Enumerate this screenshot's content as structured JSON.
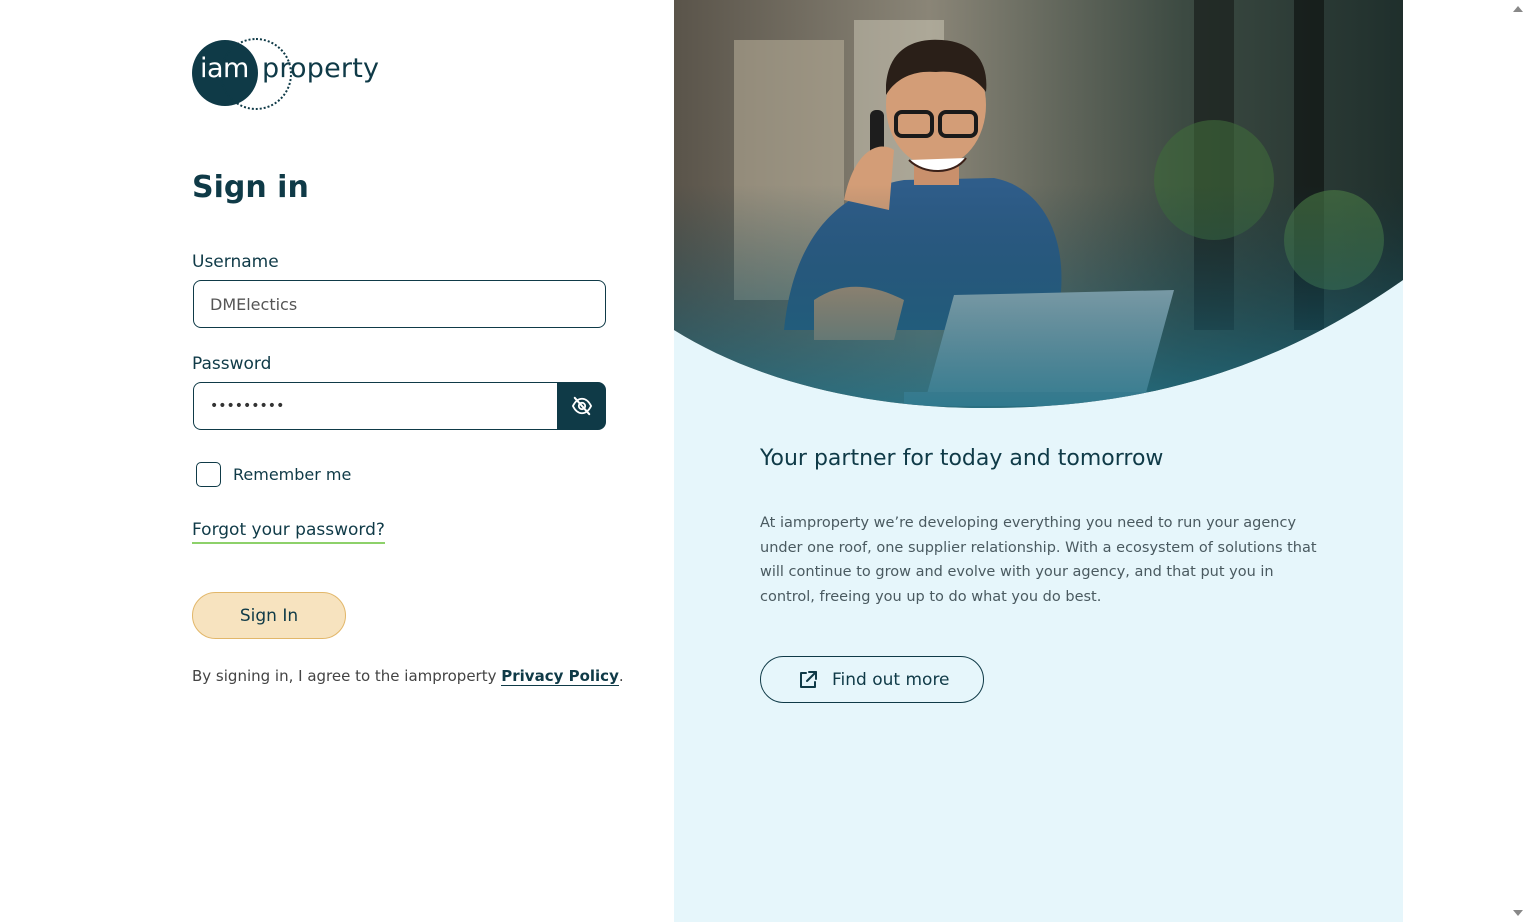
{
  "brand": {
    "logo_mark": "iam",
    "logo_word": "property"
  },
  "form": {
    "title": "Sign in",
    "username_label": "Username",
    "username_value": "DMElectics",
    "password_label": "Password",
    "password_value": "•••••••••",
    "toggle_icon": "eye-slash-icon",
    "remember_label": "Remember me",
    "remember_checked": false,
    "forgot_link": "Forgot your password?",
    "submit_label": "Sign In",
    "agree_prefix": "By signing in, I agree to the iamproperty ",
    "privacy_link": "Privacy Policy",
    "agree_suffix": "."
  },
  "panel": {
    "heading": "Your partner for today and tomorrow",
    "body": "At iamproperty we’re developing everything you need to run your agency under one roof, one supplier relationship. With a ecosystem of solutions that will continue to grow and evolve with your agency, and that put you in control, freeing you up to do what you do best.",
    "cta_label": "Find out more",
    "cta_icon": "external-link-icon"
  },
  "colors": {
    "brand_dark": "#0f3a47",
    "panel_bg": "#e6f6fb",
    "signin_bg": "#f7e3bf",
    "signin_border": "#e2b76a",
    "link_underline": "#8dd16a"
  }
}
